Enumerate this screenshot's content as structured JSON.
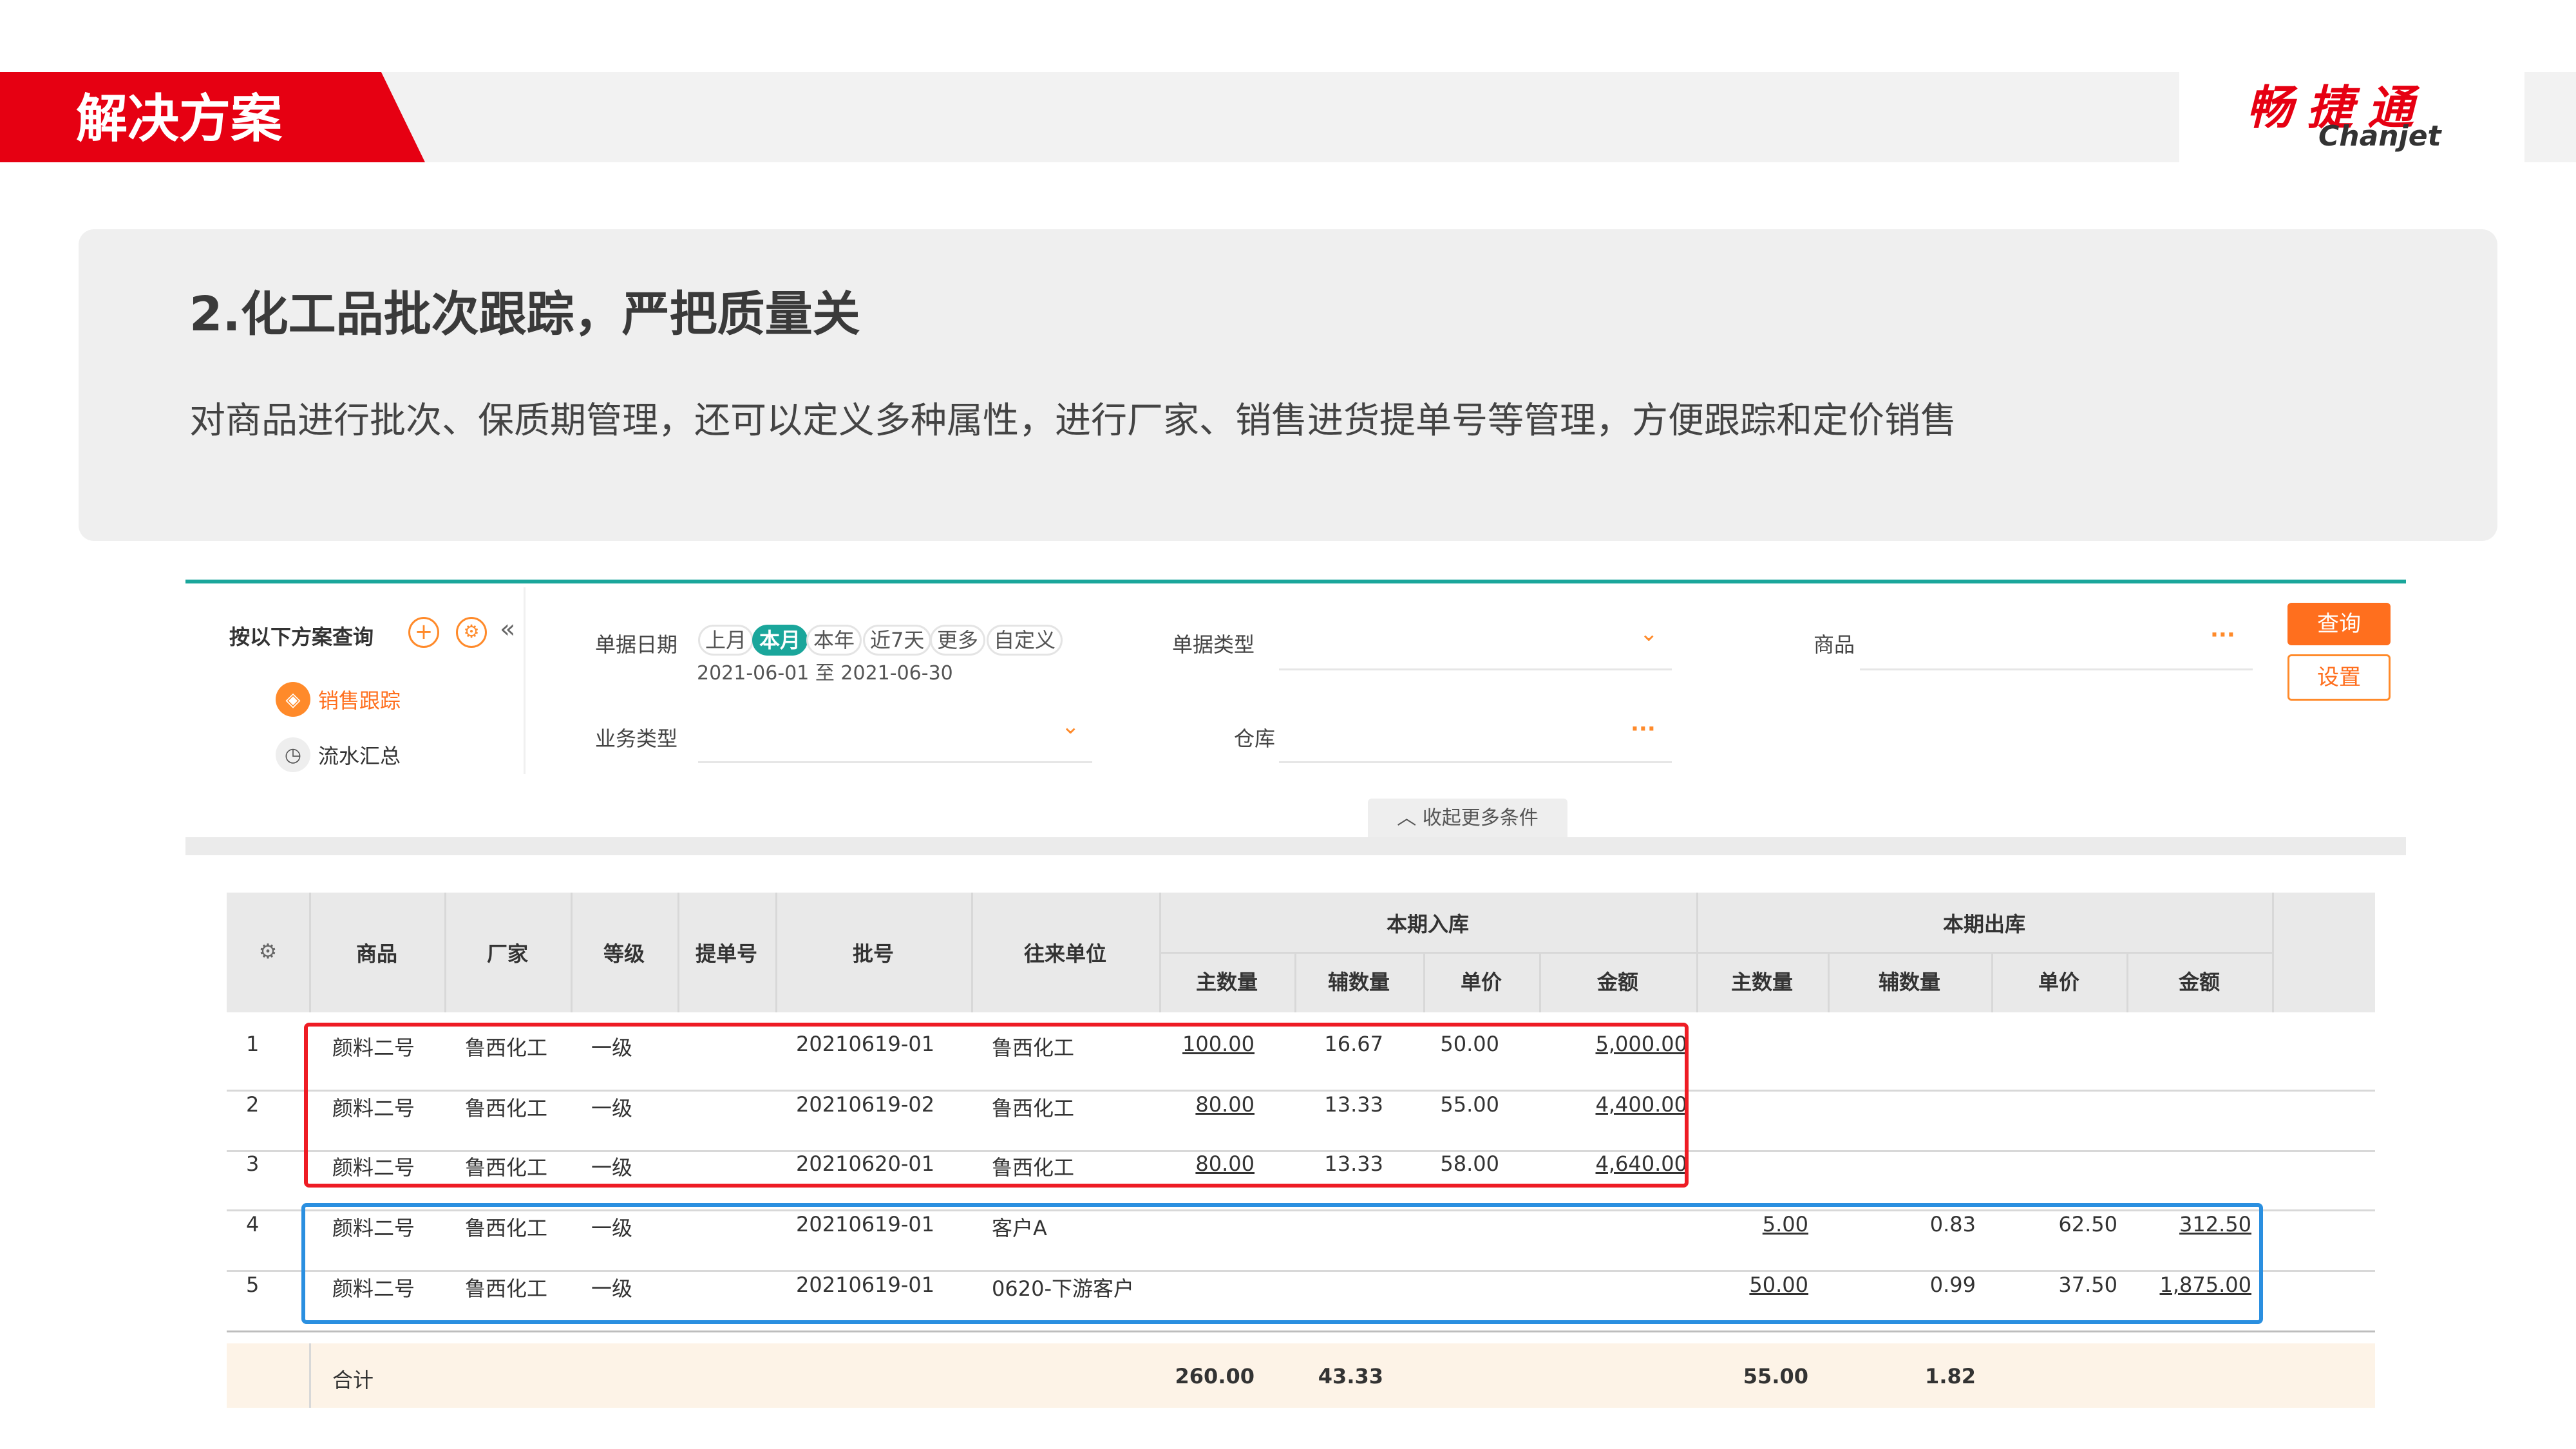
{
  "header": {
    "section_title": "解决方案",
    "brand_cn": "畅捷通",
    "brand_en": "Chanjet",
    "brand_color": "#e60012"
  },
  "intro": {
    "title": "2.化工品批次跟踪，严把质量关",
    "description": "对商品进行批次、保质期管理，还可以定义多种属性，进行厂家、销售进货提单号等管理，方便跟踪和定价销售"
  },
  "left_panel": {
    "title": "按以下方案查询",
    "add_icon": "plus-icon",
    "settings_icon": "gear-icon",
    "collapse_icon": "double-chevron-left-icon",
    "items": [
      {
        "label": "销售跟踪",
        "active": true
      },
      {
        "label": "流水汇总",
        "active": false
      }
    ]
  },
  "filters": {
    "doc_date_label": "单据日期",
    "periods": [
      "上月",
      "本月",
      "本年",
      "近7天",
      "更多",
      "自定义"
    ],
    "active_period": "本月",
    "date_range": "2021-06-01 至 2021-06-30",
    "doc_type_label": "单据类型",
    "product_label": "商品",
    "business_type_label": "业务类型",
    "warehouse_label": "仓库",
    "collapse_more": "收起更多条件",
    "query_button": "查询",
    "settings_button": "设置",
    "accent_color": "#1aa69b",
    "orange_color": "#ff6f1e"
  },
  "table": {
    "columns": [
      "商品",
      "厂家",
      "等级",
      "提单号",
      "批号",
      "往来单位"
    ],
    "group_in": "本期入库",
    "group_out": "本期出库",
    "sub_columns": [
      "主数量",
      "辅数量",
      "单价",
      "金额"
    ],
    "rows": [
      {
        "no": "1",
        "product": "颜料二号",
        "maker": "鲁西化工",
        "grade": "一级",
        "bill": "",
        "batch": "20210619-01",
        "partner": "鲁西化工",
        "in_qty": "100.00",
        "in_aux": "16.67",
        "in_price": "50.00",
        "in_amount": "5,000.00",
        "out_qty": "",
        "out_aux": "",
        "out_price": "",
        "out_amount": ""
      },
      {
        "no": "2",
        "product": "颜料二号",
        "maker": "鲁西化工",
        "grade": "一级",
        "bill": "",
        "batch": "20210619-02",
        "partner": "鲁西化工",
        "in_qty": "80.00",
        "in_aux": "13.33",
        "in_price": "55.00",
        "in_amount": "4,400.00",
        "out_qty": "",
        "out_aux": "",
        "out_price": "",
        "out_amount": ""
      },
      {
        "no": "3",
        "product": "颜料二号",
        "maker": "鲁西化工",
        "grade": "一级",
        "bill": "",
        "batch": "20210620-01",
        "partner": "鲁西化工",
        "in_qty": "80.00",
        "in_aux": "13.33",
        "in_price": "58.00",
        "in_amount": "4,640.00",
        "out_qty": "",
        "out_aux": "",
        "out_price": "",
        "out_amount": ""
      },
      {
        "no": "4",
        "product": "颜料二号",
        "maker": "鲁西化工",
        "grade": "一级",
        "bill": "",
        "batch": "20210619-01",
        "partner": "客户A",
        "in_qty": "",
        "in_aux": "",
        "in_price": "",
        "in_amount": "",
        "out_qty": "5.00",
        "out_aux": "0.83",
        "out_price": "62.50",
        "out_amount": "312.50"
      },
      {
        "no": "5",
        "product": "颜料二号",
        "maker": "鲁西化工",
        "grade": "一级",
        "bill": "",
        "batch": "20210619-01",
        "partner": "0620-下游客户",
        "in_qty": "",
        "in_aux": "",
        "in_price": "",
        "in_amount": "",
        "out_qty": "50.00",
        "out_aux": "0.99",
        "out_price": "37.50",
        "out_amount": "1,875.00"
      }
    ],
    "total": {
      "label": "合计",
      "in_qty": "260.00",
      "in_aux": "43.33",
      "out_qty": "55.00",
      "out_aux": "1.82"
    },
    "highlight_in_color": "#ee1c24",
    "highlight_out_color": "#2a8fe0"
  }
}
